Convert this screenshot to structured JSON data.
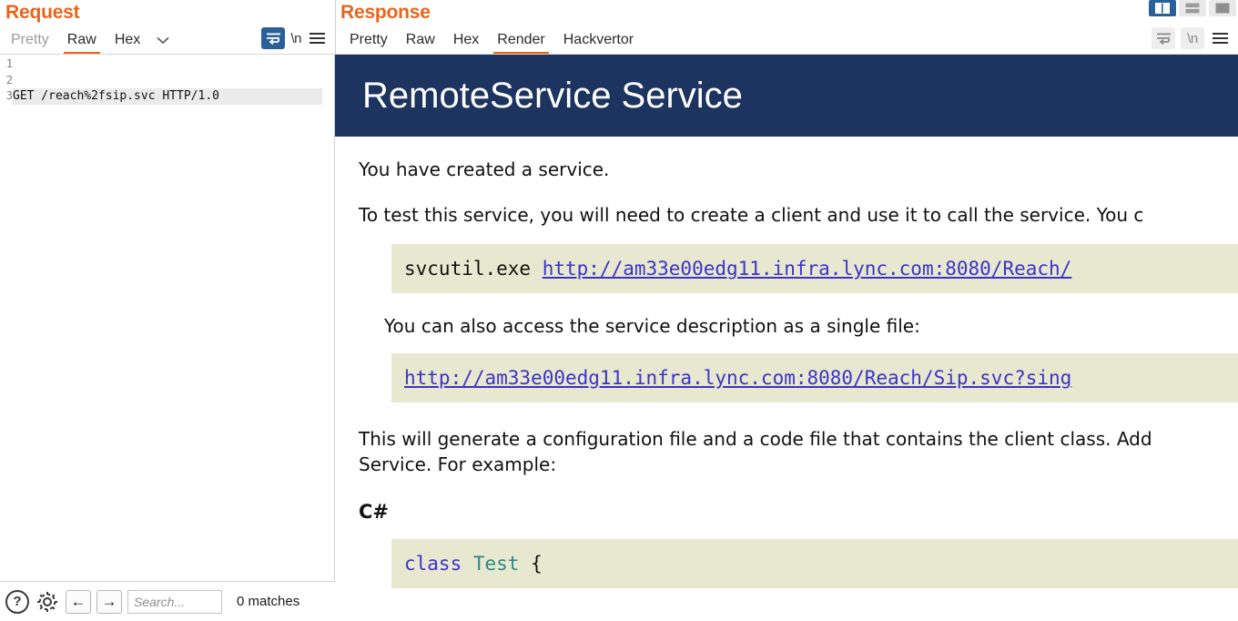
{
  "request": {
    "title": "Request",
    "tabs": [
      {
        "label": "Pretty",
        "active": false
      },
      {
        "label": "Raw",
        "active": true
      },
      {
        "label": "Hex",
        "active": false
      }
    ],
    "chevron": "∨",
    "icons": {
      "word_wrap": "word-wrap-icon",
      "newline": "\\n",
      "menu": "hamburger-menu-icon"
    },
    "line_numbers": [
      "1",
      "2",
      "3"
    ],
    "code_lines": [
      "GET /reach%2fsip.svc HTTP/1.0",
      "",
      ""
    ]
  },
  "search": {
    "help_label": "?",
    "placeholder": "Search...",
    "value": "",
    "matches": "0 matches",
    "prev": "←",
    "next": "→"
  },
  "response": {
    "title": "Response",
    "tabs": [
      {
        "label": "Pretty",
        "active": false
      },
      {
        "label": "Raw",
        "active": false
      },
      {
        "label": "Hex",
        "active": false
      },
      {
        "label": "Render",
        "active": true
      },
      {
        "label": "Hackvertor",
        "active": false
      }
    ],
    "icons": {
      "word_wrap": "word-wrap-icon",
      "newline": "\\n",
      "menu": "hamburger-menu-icon"
    }
  },
  "layout_buttons": [
    {
      "name": "vertical-split",
      "active": true
    },
    {
      "name": "horizontal-split",
      "active": false
    },
    {
      "name": "single-pane",
      "active": false
    }
  ],
  "rendered_page": {
    "banner_title": "RemoteService Service",
    "banner_color": "#1d3461",
    "p1": "You have created a service.",
    "p2": "To test this service, you will need to create a client and use it to call the service. You c",
    "code1_prefix": "svcutil.exe ",
    "code1_link": "http://am33e00edg11.infra.lync.com:8080/Reach/",
    "p3": "You can also access the service description as a single file:",
    "code2_link": "http://am33e00edg11.infra.lync.com:8080/Reach/Sip.svc?sing",
    "p4_line1": "This will generate a configuration file and a code file that contains the client class. Add",
    "p4_line2": "Service. For example:",
    "lang_heading": "C#",
    "code3_keyword": "class",
    "code3_type": "Test",
    "code3_brace": "{"
  }
}
